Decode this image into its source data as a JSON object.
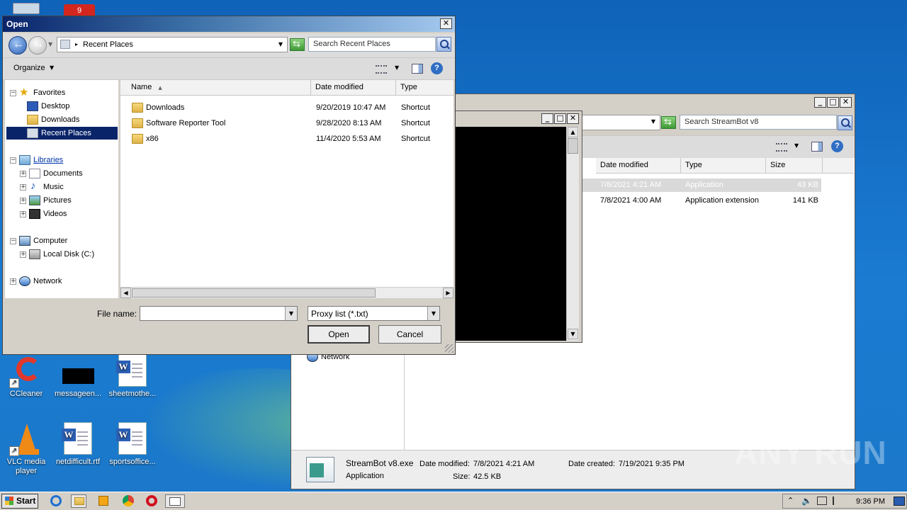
{
  "desktop": {
    "icons": [
      {
        "label": "CCleaner"
      },
      {
        "label": "messageen..."
      },
      {
        "label": "sheetmothe..."
      },
      {
        "label": "VLC media player"
      },
      {
        "label": "netdifficult.rtf"
      },
      {
        "label": "sportsoffice..."
      }
    ],
    "top_badge": "9"
  },
  "explorer": {
    "search_placeholder": "Search StreamBot v8",
    "columns": [
      "Date modified",
      "Type",
      "Size"
    ],
    "rows": [
      {
        "date": "7/8/2021 4:21 AM",
        "type": "Application",
        "size": "43 KB"
      },
      {
        "date": "7/8/2021 4:00 AM",
        "type": "Application extension",
        "size": "141 KB"
      }
    ],
    "tree_network": "Network",
    "details": {
      "filename": "StreamBot v8.exe",
      "filetype": "Application",
      "date_modified_label": "Date modified:",
      "date_modified": "7/8/2021 4:21 AM",
      "size_label": "Size:",
      "size": "42.5 KB",
      "date_created_label": "Date created:",
      "date_created": "7/19/2021 9:35 PM"
    }
  },
  "dialog": {
    "title": "Open",
    "address": "Recent Places",
    "search_placeholder": "Search Recent Places",
    "organize": "Organize",
    "tree": {
      "favorites": "Favorites",
      "desktop": "Desktop",
      "downloads": "Downloads",
      "recent": "Recent Places",
      "libraries": "Libraries",
      "documents": "Documents",
      "music": "Music",
      "pictures": "Pictures",
      "videos": "Videos",
      "computer": "Computer",
      "local_disk": "Local Disk (C:)",
      "network": "Network"
    },
    "columns": {
      "name": "Name",
      "date": "Date modified",
      "type": "Type"
    },
    "files": [
      {
        "name": "Downloads",
        "date": "9/20/2019 10:47 AM",
        "type": "Shortcut"
      },
      {
        "name": "Software Reporter Tool",
        "date": "9/28/2020 8:13 AM",
        "type": "Shortcut"
      },
      {
        "name": "x86",
        "date": "11/4/2020 5:53 AM",
        "type": "Shortcut"
      }
    ],
    "filename_label": "File name:",
    "filename_value": "",
    "filter_value": "Proxy list (*.txt)",
    "open_label": "Open",
    "cancel_label": "Cancel"
  },
  "taskbar": {
    "start": "Start",
    "clock": "9:36 PM"
  },
  "watermark": "ANY RUN"
}
